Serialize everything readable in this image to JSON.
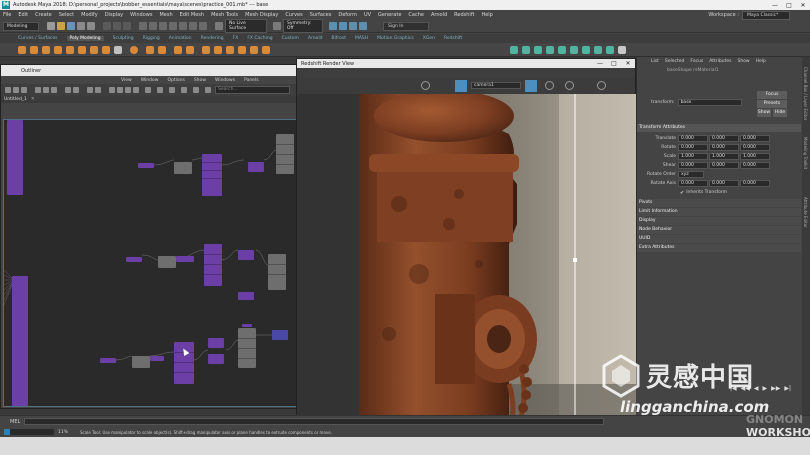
{
  "window": {
    "title": "Autodesk Maya 2018: D:\\personal_projects\\bobber_essentials\\maya\\scenes\\practice_001.mb* --- base",
    "minimize": "—",
    "maximize": "□",
    "close": "✕"
  },
  "menubar": {
    "items": [
      "File",
      "Edit",
      "Create",
      "Select",
      "Modify",
      "Display",
      "Windows",
      "Mesh",
      "Edit Mesh",
      "Mesh Tools",
      "Mesh Display",
      "Curves",
      "Surfaces",
      "Deform",
      "UV",
      "Generate",
      "Cache",
      "Arnold",
      "Redshift",
      "Help"
    ],
    "workspace_label": "Workspace :",
    "workspace_value": "Maya Classic*"
  },
  "statusline": {
    "mode": "Modeling",
    "live_surface": "No Live Surface",
    "symmetry": "Symmetry: Off",
    "sign_in": "Sign In"
  },
  "shelf": {
    "tabs": [
      "Curves / Surfaces",
      "Poly Modeling",
      "Sculpting",
      "Rigging",
      "Animation",
      "Rendering",
      "FX",
      "FX Caching",
      "Custom",
      "Arnold",
      "Bifrost",
      "MASH",
      "Motion Graphics",
      "XGen",
      "Redshift"
    ],
    "active_tab": "Poly Modeling"
  },
  "node_editor": {
    "title": "Outliner",
    "menus": [
      "View",
      "Window",
      "Options",
      "Show",
      "Windows",
      "Panels"
    ],
    "search_placeholder": "Search...",
    "tab": "Untitled_1",
    "close": "✕"
  },
  "render_view": {
    "title": "Redshift Render View",
    "camera": "camera1",
    "minimize": "—",
    "maximize": "□",
    "close": "✕"
  },
  "attribute_editor": {
    "tabs": [
      "List",
      "Selected",
      "Focus",
      "Attributes",
      "Show",
      "Help"
    ],
    "sub_tabs": "baseShape   rsMaterial1",
    "transform_label": "transform:",
    "transform_value": "base",
    "focus_btn": "Focus",
    "presets_btn": "Presets",
    "show_btn": "Show",
    "hide_btn": "Hide",
    "section_transform": "Transform Attributes",
    "rows": [
      {
        "label": "Translate",
        "values": [
          "0.000",
          "0.000",
          "0.000"
        ]
      },
      {
        "label": "Rotate",
        "values": [
          "0.000",
          "0.000",
          "0.000"
        ]
      },
      {
        "label": "Scale",
        "values": [
          "1.000",
          "1.000",
          "1.000"
        ]
      },
      {
        "label": "Shear",
        "values": [
          "0.000",
          "0.000",
          "0.000"
        ]
      }
    ],
    "rotate_order_label": "Rotate Order",
    "rotate_order_value": "xyz",
    "rotate_axis_label": "Rotate Axis",
    "rotate_axis_values": [
      "0.000",
      "0.000",
      "0.000"
    ],
    "inherits_transform": "Inherits Transform",
    "sections": [
      "Pivots",
      "Limit Information",
      "Display",
      "Node Behavior",
      "UUID",
      "Extra Attributes"
    ]
  },
  "side_tabs": [
    "Channel Box / Layer Editor",
    "Modeling Toolkit",
    "Attribute Editor"
  ],
  "playback": {
    "icons": [
      "|◀",
      "◀◀",
      "◀",
      "▶",
      "▶▶",
      "▶|"
    ]
  },
  "command_line": {
    "label": "MEL"
  },
  "help_line": {
    "progress_label": "11%",
    "progress_value": 0.11,
    "message": "Scale Tool: Use manipulator to scale object(s). Shift+drag manipulator axis or plane handles to extrude components or move."
  },
  "watermark": {
    "cn": "灵感中国",
    "url": "lingganchina.com",
    "brand_top": "GNOMON",
    "brand_bottom": "WORKSHOP"
  },
  "colors": {
    "accent": "#4c8fbf",
    "node_purple": "#6b3fa6",
    "node_grey": "#6e6e6e",
    "node_blue": "#4a48a6",
    "rust": "#8e4a2a"
  }
}
